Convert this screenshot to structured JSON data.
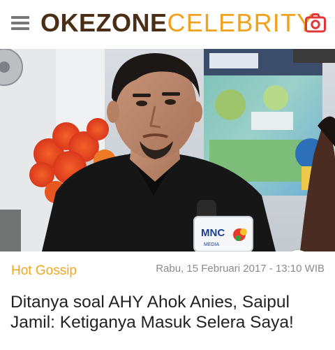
{
  "header": {
    "menu_icon": "hamburger-menu-icon",
    "brand_part1": "OKEZONE",
    "brand_part2": "CELEBRITY",
    "camera_icon": "camera-icon",
    "brand_color_dark": "#4a2f16",
    "brand_color_accent": "#f0a21c",
    "camera_color": "#e0373a"
  },
  "hero": {
    "info_icon": "info-icon",
    "info_glyph": "i",
    "mic_logo_text": "MNC",
    "mic_logo_sub": "MEDIA"
  },
  "article": {
    "category": "Hot Gossip",
    "date": "Rabu, 15 Februari 2017 - 13:10 WIB",
    "headline": "Ditanya soal AHY Ahok Anies, Saipul Jamil: Ketiganya Masuk Selera Saya!",
    "category_color": "#f2a71f"
  }
}
